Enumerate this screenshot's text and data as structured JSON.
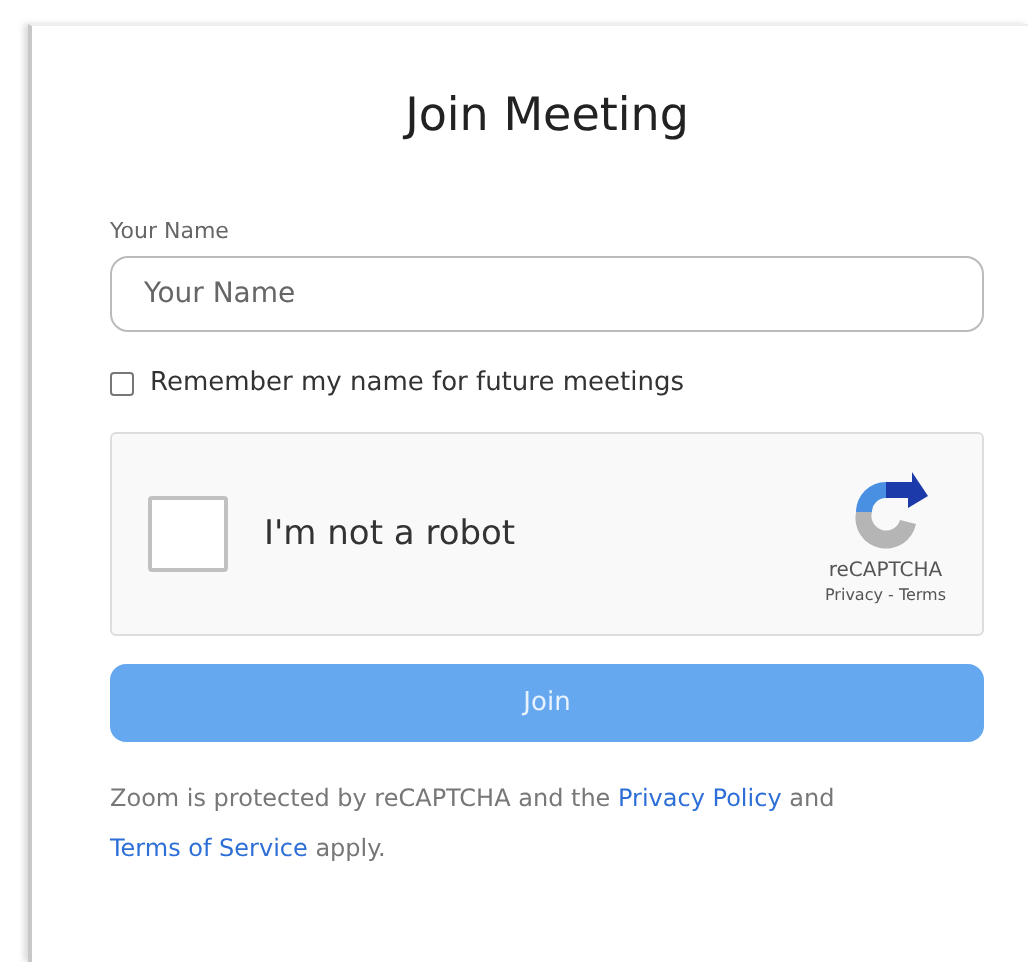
{
  "title": "Join Meeting",
  "name_field": {
    "label": "Your Name",
    "placeholder": "Your Name"
  },
  "remember": {
    "label": "Remember my name for future meetings",
    "checked": false
  },
  "captcha": {
    "label": "I'm not a robot",
    "checked": false,
    "brand": "reCAPTCHA",
    "links": "Privacy - Terms"
  },
  "join_button": {
    "label": "Join",
    "disabled": true
  },
  "footer": [
    {
      "kind": "text",
      "text": "Zoom is protected by reCAPTCHA and the "
    },
    {
      "kind": "link",
      "text": "Privacy Policy"
    },
    {
      "kind": "text",
      "text": " and "
    },
    {
      "kind": "link",
      "text": "Terms of Service"
    },
    {
      "kind": "text",
      "text": " apply."
    }
  ]
}
